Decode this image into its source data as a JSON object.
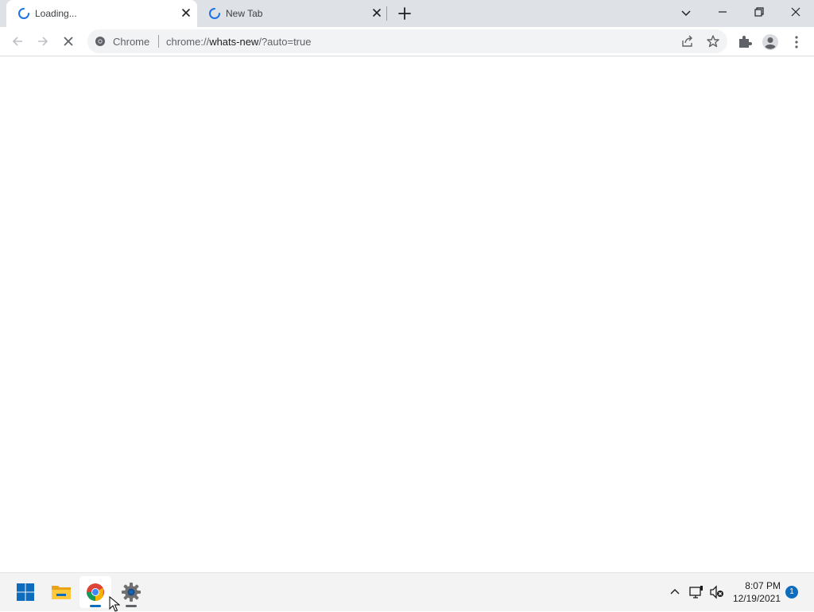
{
  "tabs": [
    {
      "title": "Loading...",
      "active": true
    },
    {
      "title": "New Tab",
      "active": false
    }
  ],
  "omnibox": {
    "chip": "Chrome",
    "url_scheme": "chrome://",
    "url_host": "whats-new",
    "url_path": "/?auto=true"
  },
  "taskbar": {
    "apps": [
      "start",
      "file-explorer",
      "chrome",
      "settings"
    ],
    "clock_time": "8:07 PM",
    "clock_date": "12/19/2021",
    "notification_count": "1"
  },
  "colors": {
    "tabstrip_bg": "#dee1e6",
    "omnibox_bg": "#f1f3f4",
    "spinner": "#1a73e8",
    "taskbar_bg": "#f3f3f3",
    "windows_blue": "#0f6cbd"
  }
}
